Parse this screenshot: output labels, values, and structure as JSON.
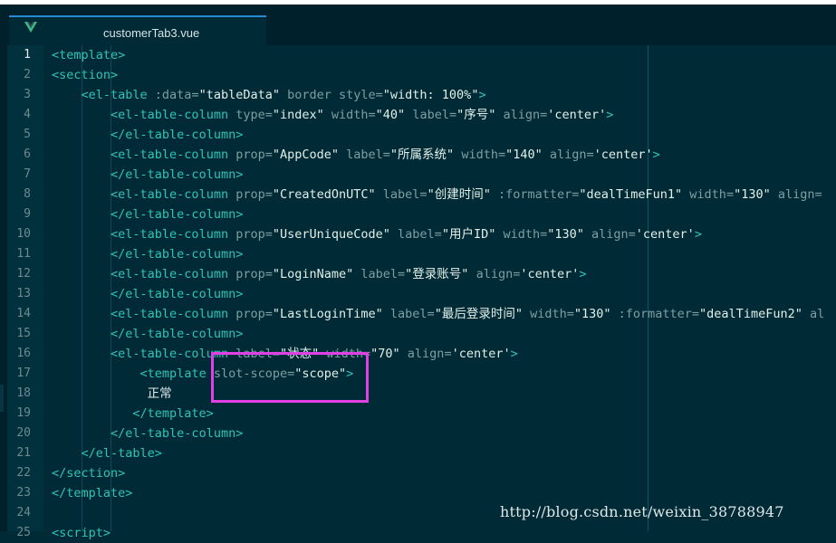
{
  "tab": {
    "title": "customerTab3.vue",
    "icon": "vue-logo-icon"
  },
  "colors": {
    "background": "#002b36",
    "tag": "#2ec4b6",
    "highlight_box": "#e040e6"
  },
  "editor": {
    "active_line": 1,
    "lines": [
      {
        "n": "1",
        "tokens": [
          [
            "tag",
            "<template"
          ],
          [
            "tag",
            ">"
          ]
        ]
      },
      {
        "n": "2",
        "tokens": [
          [
            "tag",
            "<section"
          ],
          [
            "tag",
            ">"
          ]
        ]
      },
      {
        "n": "3",
        "tokens": [
          [
            "plain",
            "    "
          ],
          [
            "tag",
            "<el-table"
          ],
          [
            "attr",
            " :data="
          ],
          [
            "str",
            "\"tableData\""
          ],
          [
            "attr",
            " border style="
          ],
          [
            "str",
            "\"width: 100%\""
          ],
          [
            "tag",
            ">"
          ]
        ]
      },
      {
        "n": "4",
        "tokens": [
          [
            "plain",
            "        "
          ],
          [
            "tag",
            "<el-table-column"
          ],
          [
            "attr",
            " type="
          ],
          [
            "str",
            "\"index\""
          ],
          [
            "attr",
            " width="
          ],
          [
            "str",
            "\"40\""
          ],
          [
            "attr",
            " label="
          ],
          [
            "str",
            "\"序号\""
          ],
          [
            "attr",
            " align="
          ],
          [
            "str",
            "'center'"
          ],
          [
            "tag",
            ">"
          ]
        ]
      },
      {
        "n": "5",
        "tokens": [
          [
            "plain",
            "        "
          ],
          [
            "tag",
            "</el-table-column>"
          ]
        ]
      },
      {
        "n": "6",
        "tokens": [
          [
            "plain",
            "        "
          ],
          [
            "tag",
            "<el-table-column"
          ],
          [
            "attr",
            " prop="
          ],
          [
            "str",
            "\"AppCode\""
          ],
          [
            "attr",
            " label="
          ],
          [
            "str",
            "\"所属系统\""
          ],
          [
            "attr",
            " width="
          ],
          [
            "str",
            "\"140\""
          ],
          [
            "attr",
            " align="
          ],
          [
            "str",
            "'center'"
          ],
          [
            "tag",
            ">"
          ]
        ]
      },
      {
        "n": "7",
        "tokens": [
          [
            "plain",
            "        "
          ],
          [
            "tag",
            "</el-table-column>"
          ]
        ]
      },
      {
        "n": "8",
        "tokens": [
          [
            "plain",
            "        "
          ],
          [
            "tag",
            "<el-table-column"
          ],
          [
            "attr",
            " prop="
          ],
          [
            "str",
            "\"CreatedOnUTC\""
          ],
          [
            "attr",
            " label="
          ],
          [
            "str",
            "\"创建时间\""
          ],
          [
            "attr",
            " :formatter="
          ],
          [
            "str",
            "\"dealTimeFun1\""
          ],
          [
            "attr",
            " width="
          ],
          [
            "str",
            "\"130\""
          ],
          [
            "attr",
            " align="
          ]
        ]
      },
      {
        "n": "9",
        "tokens": [
          [
            "plain",
            "        "
          ],
          [
            "tag",
            "</el-table-column>"
          ]
        ]
      },
      {
        "n": "10",
        "tokens": [
          [
            "plain",
            "        "
          ],
          [
            "tag",
            "<el-table-column"
          ],
          [
            "attr",
            " prop="
          ],
          [
            "str",
            "\"UserUniqueCode\""
          ],
          [
            "attr",
            " label="
          ],
          [
            "str",
            "\"用户ID\""
          ],
          [
            "attr",
            " width="
          ],
          [
            "str",
            "\"130\""
          ],
          [
            "attr",
            " align="
          ],
          [
            "str",
            "'center'"
          ],
          [
            "tag",
            ">"
          ]
        ]
      },
      {
        "n": "11",
        "tokens": [
          [
            "plain",
            "        "
          ],
          [
            "tag",
            "</el-table-column>"
          ]
        ]
      },
      {
        "n": "12",
        "tokens": [
          [
            "plain",
            "        "
          ],
          [
            "tag",
            "<el-table-column"
          ],
          [
            "attr",
            " prop="
          ],
          [
            "str",
            "\"LoginName\""
          ],
          [
            "attr",
            " label="
          ],
          [
            "str",
            "\"登录账号\""
          ],
          [
            "attr",
            " align="
          ],
          [
            "str",
            "'center'"
          ],
          [
            "tag",
            ">"
          ]
        ]
      },
      {
        "n": "13",
        "tokens": [
          [
            "plain",
            "        "
          ],
          [
            "tag",
            "</el-table-column>"
          ]
        ]
      },
      {
        "n": "14",
        "tokens": [
          [
            "plain",
            "        "
          ],
          [
            "tag",
            "<el-table-column"
          ],
          [
            "attr",
            " prop="
          ],
          [
            "str",
            "\"LastLoginTime\""
          ],
          [
            "attr",
            " label="
          ],
          [
            "str",
            "\"最后登录时间\""
          ],
          [
            "attr",
            " width="
          ],
          [
            "str",
            "\"130\""
          ],
          [
            "attr",
            " :formatter="
          ],
          [
            "str",
            "\"dealTimeFun2\""
          ],
          [
            "attr",
            " al"
          ]
        ]
      },
      {
        "n": "15",
        "tokens": [
          [
            "plain",
            "        "
          ],
          [
            "tag",
            "</el-table-column>"
          ]
        ]
      },
      {
        "n": "16",
        "tokens": [
          [
            "plain",
            "        "
          ],
          [
            "tag",
            "<el-table-column"
          ],
          [
            "attr",
            " label="
          ],
          [
            "str",
            "\"状态\""
          ],
          [
            "attr",
            " width="
          ],
          [
            "str",
            "\"70\""
          ],
          [
            "attr",
            " align="
          ],
          [
            "str",
            "'center'"
          ],
          [
            "tag",
            ">"
          ]
        ]
      },
      {
        "n": "17",
        "tokens": [
          [
            "plain",
            "            "
          ],
          [
            "tag",
            "<template"
          ],
          [
            "attr",
            " slot-scope="
          ],
          [
            "str",
            "\"scope\""
          ],
          [
            "tag",
            ">"
          ]
        ]
      },
      {
        "n": "18",
        "tokens": [
          [
            "plain",
            "             "
          ],
          [
            "text",
            "正常"
          ]
        ]
      },
      {
        "n": "19",
        "tokens": [
          [
            "plain",
            "           "
          ],
          [
            "tag",
            "</template>"
          ]
        ]
      },
      {
        "n": "20",
        "tokens": [
          [
            "plain",
            "        "
          ],
          [
            "tag",
            "</el-table-column>"
          ]
        ]
      },
      {
        "n": "21",
        "tokens": [
          [
            "plain",
            "    "
          ],
          [
            "tag",
            "</el-table>"
          ]
        ]
      },
      {
        "n": "22",
        "tokens": [
          [
            "tag",
            "</section>"
          ]
        ]
      },
      {
        "n": "23",
        "tokens": [
          [
            "tag",
            "</template>"
          ]
        ]
      },
      {
        "n": "24",
        "tokens": []
      },
      {
        "n": "25",
        "tokens": [
          [
            "tag",
            "<script>"
          ]
        ]
      }
    ]
  },
  "watermark": "http://blog.csdn.net/weixin_38788947"
}
